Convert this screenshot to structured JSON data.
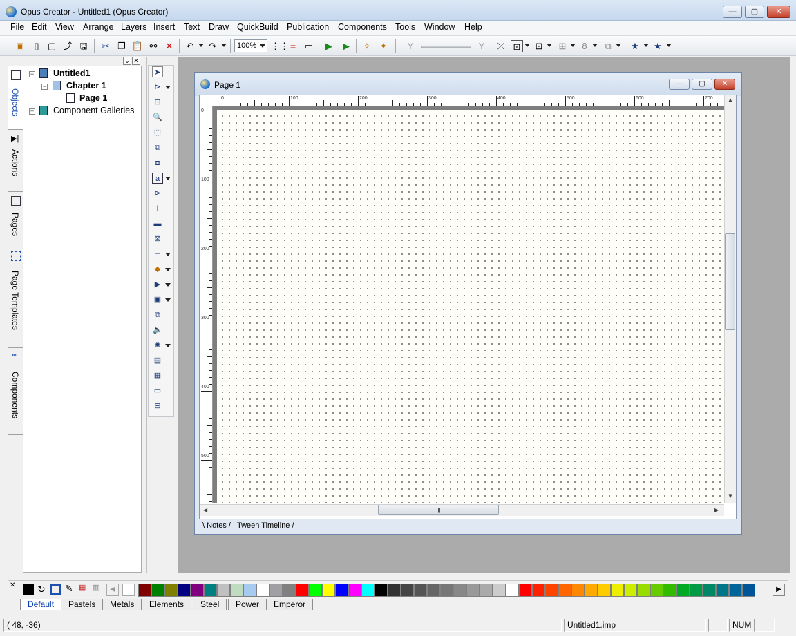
{
  "window": {
    "title": "Opus Creator - Untitled1 (Opus Creator)",
    "minimize": "—",
    "maximize": "▢",
    "close": "✕"
  },
  "menu": [
    "File",
    "Edit",
    "View",
    "Arrange",
    "Layers",
    "Insert",
    "Text",
    "Draw",
    "QuickBuild",
    "Publication",
    "Components",
    "Tools",
    "Window",
    "Help"
  ],
  "toolbar": {
    "zoom": "100%"
  },
  "panel": {
    "tabs": [
      "Objects",
      "Actions",
      "Pages",
      "Page Templates",
      "Components"
    ],
    "tree": {
      "root": "Untitled1",
      "chapter": "Chapter 1",
      "page": "Page 1",
      "galleries": "Component Galleries"
    }
  },
  "page_window": {
    "title": "Page 1",
    "ruler_top": [
      "0",
      "100",
      "200",
      "300",
      "400",
      "500",
      "600",
      "700"
    ],
    "ruler_left": [
      "0",
      "100",
      "200",
      "300",
      "400",
      "500"
    ],
    "tabs": [
      "Notes",
      "Tween Timeline"
    ]
  },
  "palette": {
    "tabs": [
      "Default",
      "Pastels",
      "Metals",
      "Elements",
      "Steel",
      "Power",
      "Emperor"
    ],
    "active_tab": "Default",
    "colors": [
      "#800000",
      "#008000",
      "#808000",
      "#000080",
      "#800080",
      "#008080",
      "#c0c0c0",
      "#c0dcc0",
      "#a6caf0",
      "#ffffff",
      "#a0a0a4",
      "#808080",
      "#ff0000",
      "#00ff00",
      "#ffff00",
      "#0000ff",
      "#ff00ff",
      "#00ffff",
      "#000000",
      "#333333",
      "#444444",
      "#555555",
      "#666666",
      "#777777",
      "#888888",
      "#999999",
      "#aaaaaa",
      "#cccccc",
      "#ffffff",
      "#ff0000",
      "#ff2200",
      "#ff4400",
      "#ff6600",
      "#ff8800",
      "#ffaa00",
      "#ffcc00",
      "#eeee00",
      "#ccee00",
      "#99dd00",
      "#66cc00",
      "#33bb00",
      "#00aa22",
      "#009944",
      "#008866",
      "#007788",
      "#006699",
      "#005599"
    ]
  },
  "status": {
    "coords": "( 48,  -36)",
    "file": "Untitled1.imp",
    "num": "NUM"
  }
}
